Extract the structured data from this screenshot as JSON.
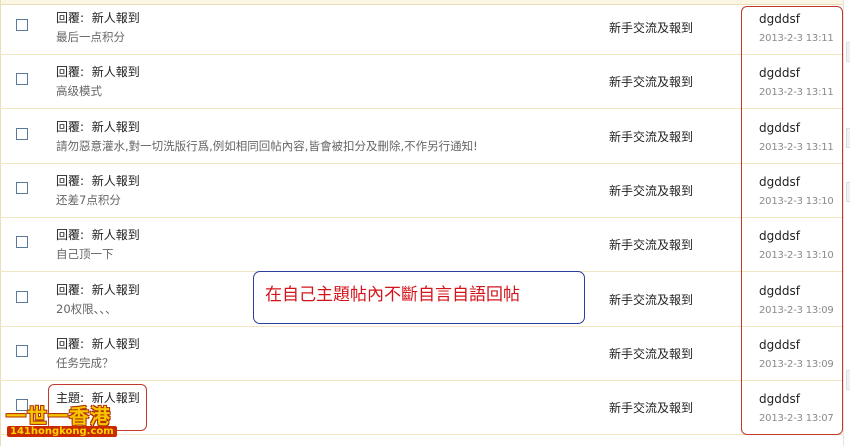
{
  "rows": [
    {
      "prefix": "回覆:",
      "thread": "新人報到",
      "subtitle": "最后一点积分",
      "forum": "新手交流及報到",
      "author": "dgddsf",
      "time": "2013-2-3 13:11"
    },
    {
      "prefix": "回覆:",
      "thread": "新人報到",
      "subtitle": "高级模式",
      "forum": "新手交流及報到",
      "author": "dgddsf",
      "time": "2013-2-3 13:11"
    },
    {
      "prefix": "回覆:",
      "thread": "新人報到",
      "subtitle": "請勿惡意灌水,對一切洗版行爲,例如相同回帖內容,皆會被扣分及刪除,不作另行通知!",
      "forum": "新手交流及報到",
      "author": "dgddsf",
      "time": "2013-2-3 13:11"
    },
    {
      "prefix": "回覆:",
      "thread": "新人報到",
      "subtitle": "还差7点积分",
      "forum": "新手交流及報到",
      "author": "dgddsf",
      "time": "2013-2-3 13:10"
    },
    {
      "prefix": "回覆:",
      "thread": "新人報到",
      "subtitle": "自己顶一下",
      "forum": "新手交流及報到",
      "author": "dgddsf",
      "time": "2013-2-3 13:10"
    },
    {
      "prefix": "回覆:",
      "thread": "新人報到",
      "subtitle": "20权限、、、",
      "forum": "新手交流及報到",
      "author": "dgddsf",
      "time": "2013-2-3 13:09"
    },
    {
      "prefix": "回覆:",
      "thread": "新人報到",
      "subtitle": "任务完成？",
      "forum": "新手交流及報到",
      "author": "dgddsf",
      "time": "2013-2-3 13:09"
    },
    {
      "prefix": "主題:",
      "thread": "新人報到",
      "subtitle": "",
      "forum": "新手交流及報到",
      "author": "dgddsf",
      "time": "2013-2-3 13:07"
    }
  ],
  "annotation": {
    "callout_text": "在自己主題帖內不斷自言自語回帖",
    "color": "#d4141b"
  },
  "watermark": {
    "title": "一世一香港",
    "url": "141hongkong.com"
  },
  "colors": {
    "row_border": "#f2e6c2",
    "annotation_box": "#c0392b",
    "callout_border": "#2c3e9b"
  }
}
